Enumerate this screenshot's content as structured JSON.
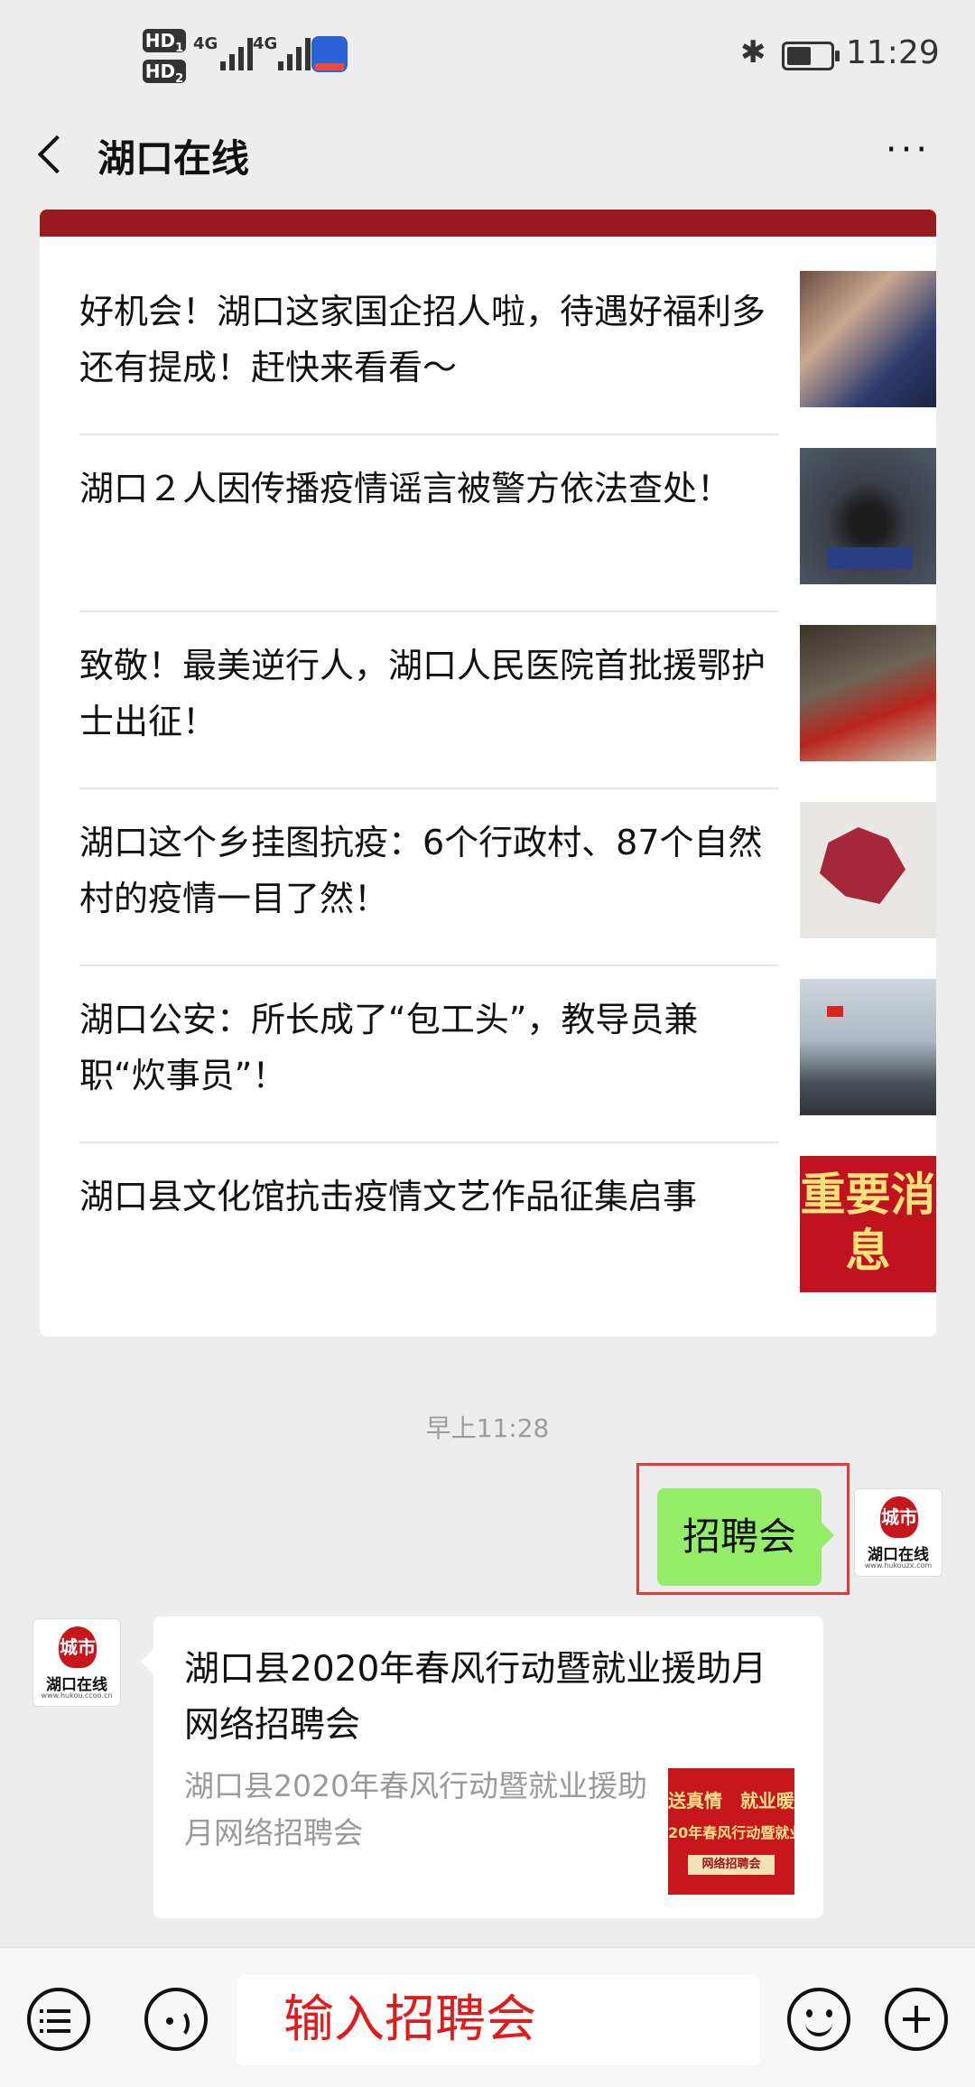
{
  "status_bar": {
    "hd1": "HD",
    "hd1_sub": "1",
    "hd2": "HD",
    "hd2_sub": "2",
    "net1": "4G",
    "net2": "4G",
    "time": "11:29"
  },
  "nav": {
    "title": "湖口在线",
    "more": "···"
  },
  "articles": [
    {
      "title": "好机会！湖口这家国企招人啦，待遇好福利多还有提成！赶快来看看～"
    },
    {
      "title": "湖口２人因传播疫情谣言被警方依法查处！"
    },
    {
      "title": "致敬！最美逆行人，湖口人民医院首批援鄂护士出征！"
    },
    {
      "title": "湖口这个乡挂图抗疫：6个行政村、87个自然村的疫情一目了然！"
    },
    {
      "title": "湖口公安：所长成了“包工头”，教导员兼职“炊事员”！"
    },
    {
      "title": "湖口县文化馆抗击疫情文艺作品征集启事",
      "thumb_text": "重要消息"
    }
  ],
  "chat": {
    "timestamp": "早上11:28",
    "sent_message": "招聘会",
    "avatar_seal": "城市",
    "avatar_caption": "湖口在线",
    "avatar_url_right": "www.hukouzx.com",
    "avatar_url_left": "www.hukou.ccoo.cn",
    "reply": {
      "title": "湖口县2020年春风行动暨就业援助月网络招聘会",
      "description": "湖口县2020年春风行动暨就业援助月网络招聘会",
      "thumb_line1": "送真情　就业暖",
      "thumb_line2": "20年春风行动暨就业",
      "thumb_tag": "网络招聘会"
    }
  },
  "input_bar": {
    "input_value": "输入招聘会"
  }
}
